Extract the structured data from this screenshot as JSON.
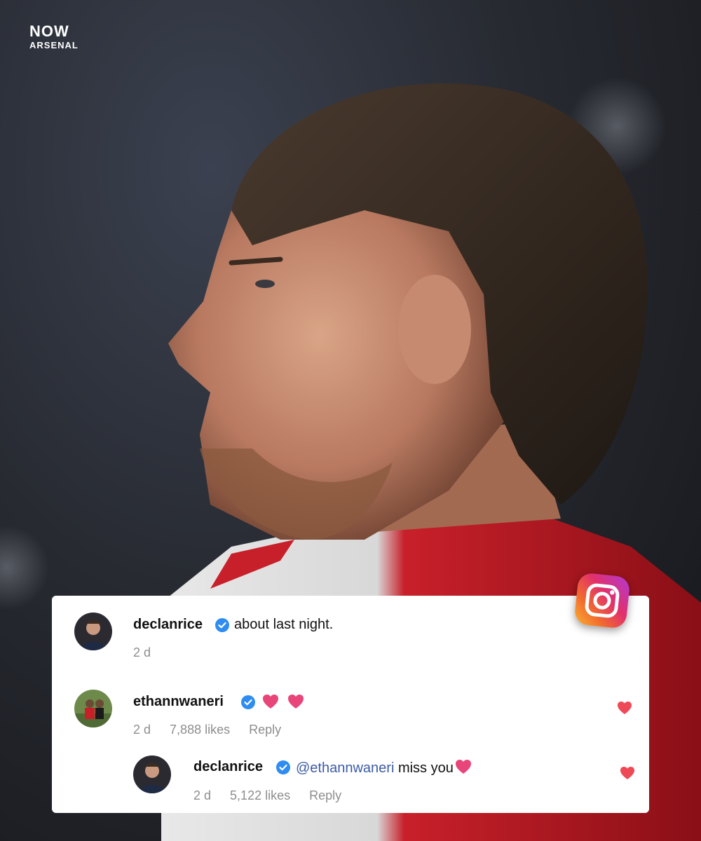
{
  "brand": {
    "line1": "NOW",
    "line2": "ARSENAL"
  },
  "platform_icon": "instagram-icon",
  "comments": [
    {
      "username": "declanrice",
      "verified": true,
      "text": "about last night.",
      "time": "2 d"
    },
    {
      "username": "ethannwaneri",
      "verified": true,
      "text": "",
      "emojis": [
        "heart-emoji",
        "heart-emoji"
      ],
      "time": "2 d",
      "likes": "7,888 likes",
      "reply": "Reply",
      "liked": true
    },
    {
      "username": "declanrice",
      "verified": true,
      "mention": "@ethannwaneri",
      "text": "miss you",
      "emojis": [
        "heart-emoji"
      ],
      "time": "2 d",
      "likes": "5,122 likes",
      "reply": "Reply",
      "liked": true
    }
  ],
  "colors": {
    "verified": "#2f8cf0",
    "like_heart": "#ed4956",
    "mention": "#3b5ba5",
    "meta": "#8e8e8e"
  }
}
